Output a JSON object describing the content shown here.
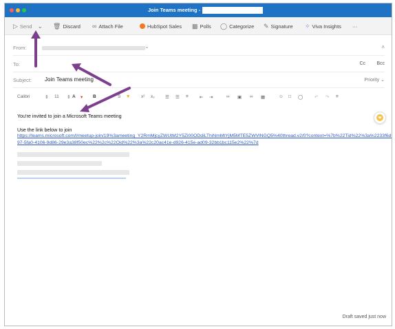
{
  "window": {
    "title": "Join Teams meeting -"
  },
  "toolbar": {
    "send_label": "Send",
    "discard_label": "Discard",
    "attach_label": "Attach File",
    "hubspot_label": "HubSpot Sales",
    "polls_label": "Polls",
    "categorize_label": "Categorize",
    "signature_label": "Signature",
    "viva_label": "Viva Insights",
    "more_label": "···"
  },
  "header": {
    "from_label": "From:",
    "to_label": "To:",
    "cc_label": "Cc",
    "bcc_label": "Bcc",
    "subject_label": "Subject:",
    "subject_value": "Join Teams meeting",
    "priority_label": "Priority"
  },
  "format": {
    "font": "Calibri",
    "size": "11"
  },
  "body": {
    "invite_line": "You're invited to join a Microsoft Teams meeting",
    "link_intro": "Use the link below to join",
    "meeting_link": "https://teams.microsoft.com/l/meetup-join/19%3ameeting_Y2RmMjcyZWUtM2Y5Zi00ODdiLThiNmMtYjM5MTE5ZWVlNGQ5%40thread.v2/0?context=%7b%22Tid%22%3a%2233f6df97-5fa0-4106-9d86-29e3a38f50ec%22%2c%22Oid%22%3a%22c20ac41e-d926-415e-ad09-32bb1bc115e2%22%7d"
  },
  "status": {
    "draft_saved": "Draft saved just now"
  },
  "colors": {
    "titlebar": "#1e73c4",
    "link": "#2b57c4",
    "arrow": "#7b3f8c"
  }
}
